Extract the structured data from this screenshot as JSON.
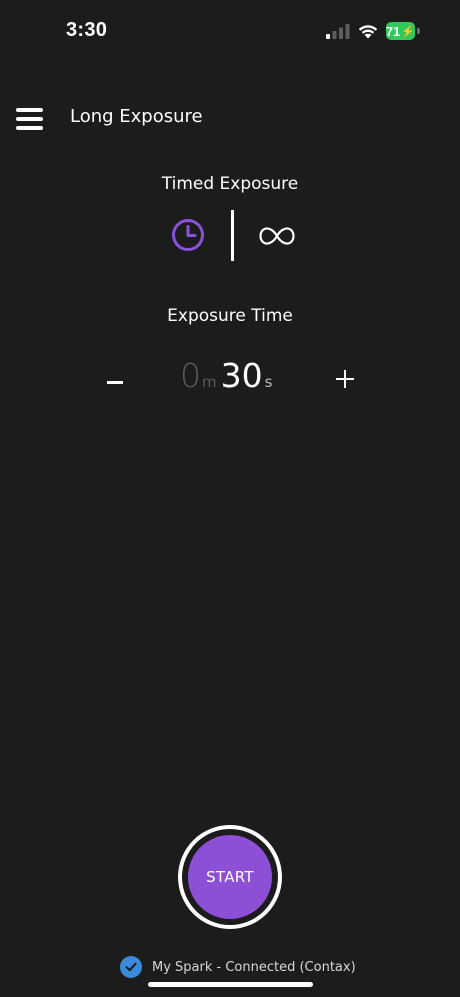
{
  "status_bar": {
    "time": "3:30",
    "battery_level": "71",
    "icons": [
      "signal-icon",
      "wifi-icon",
      "battery-charging-icon"
    ]
  },
  "header": {
    "title": "Long Exposure",
    "menu_icon": "hamburger-menu-icon"
  },
  "mode": {
    "label": "Timed Exposure",
    "options": [
      {
        "icon": "clock-icon",
        "selected": true
      },
      {
        "icon": "infinity-icon",
        "selected": false
      }
    ]
  },
  "exposure": {
    "label": "Exposure Time",
    "minutes_value": "0",
    "minutes_unit": "m",
    "seconds_value": "30",
    "seconds_unit": "s",
    "decrement_label": "-",
    "increment_label": "+"
  },
  "start_button": {
    "label": "START"
  },
  "connection": {
    "icon": "check-circle-icon",
    "text": "My Spark - Connected (Contax)"
  },
  "colors": {
    "background": "#1c1c1c",
    "accent_purple": "#8c4fd6",
    "clock_purple": "#8a52d8",
    "connected_blue": "#3b8ad9",
    "battery_green": "#34c759"
  }
}
